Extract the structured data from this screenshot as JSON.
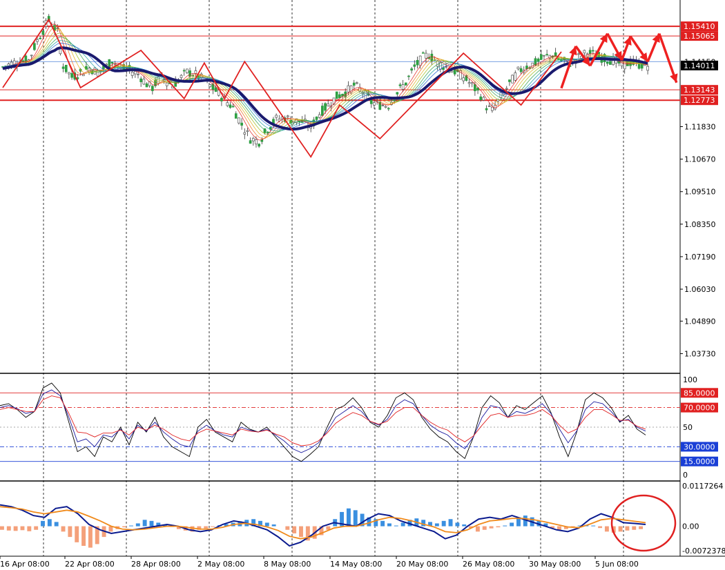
{
  "chart_data": [
    {
      "type": "line",
      "title": "",
      "price_axis": {
        "ylim": [
          1.0315,
          1.1625
        ],
        "tick_labels": [
          "1.11830",
          "1.10670",
          "1.09510",
          "1.08350",
          "1.07190",
          "1.06030",
          "1.04890",
          "1.03730"
        ],
        "tick_values": [
          1.1183,
          1.1067,
          1.0951,
          1.0835,
          1.0719,
          1.0603,
          1.0489,
          1.0373
        ]
      },
      "x_axis": {
        "date_labels": [
          "16 Apr 08:00",
          "22 Apr 08:00",
          "28 Apr 08:00",
          "2 May 08:00",
          "8 May 08:00",
          "14 May 08:00",
          "20 May 08:00",
          "26 May 08:00",
          "30 May 08:00",
          "5 Jun 08:00"
        ],
        "bar_count": 118
      },
      "price_path": [
        [
          0,
          1.1395
        ],
        [
          4,
          1.1412
        ],
        [
          9,
          1.142
        ],
        [
          12,
          1.149
        ],
        [
          16,
          1.1565
        ],
        [
          19,
          1.152
        ],
        [
          21,
          1.14
        ],
        [
          24,
          1.136
        ],
        [
          27,
          1.1375
        ],
        [
          30,
          1.1392
        ],
        [
          33,
          1.1378
        ],
        [
          36,
          1.1398
        ],
        [
          38,
          1.142
        ],
        [
          41,
          1.139
        ],
        [
          44,
          1.1385
        ],
        [
          47,
          1.137
        ],
        [
          50,
          1.1335
        ],
        [
          52,
          1.1322
        ],
        [
          55,
          1.1362
        ],
        [
          57,
          1.1345
        ],
        [
          59,
          1.133
        ],
        [
          62,
          1.1358
        ],
        [
          64,
          1.1378
        ],
        [
          67,
          1.1368
        ],
        [
          70,
          1.1348
        ],
        [
          73,
          1.132
        ],
        [
          76,
          1.129
        ],
        [
          80,
          1.125
        ],
        [
          83,
          1.119
        ],
        [
          86,
          1.114
        ],
        [
          89,
          1.113
        ],
        [
          92,
          1.1175
        ],
        [
          95,
          1.121
        ],
        [
          98,
          1.1215
        ],
        [
          101,
          1.1205
        ],
        [
          104,
          1.12
        ],
        [
          107,
          1.118
        ],
        [
          110,
          1.123
        ],
        [
          113,
          1.126
        ],
        [
          116,
          1.129
        ],
        [
          119,
          1.1305
        ],
        [
          122,
          1.133
        ],
        [
          125,
          1.131
        ],
        [
          128,
          1.127
        ],
        [
          131,
          1.126
        ],
        [
          134,
          1.126
        ],
        [
          137,
          1.1305
        ],
        [
          140,
          1.134
        ],
        [
          143,
          1.1395
        ],
        [
          146,
          1.143
        ],
        [
          148,
          1.144
        ],
        [
          151,
          1.141
        ],
        [
          154,
          1.1395
        ],
        [
          157,
          1.138
        ],
        [
          160,
          1.136
        ],
        [
          163,
          1.133
        ],
        [
          166,
          1.1295
        ],
        [
          168,
          1.1255
        ],
        [
          170,
          1.124
        ],
        [
          173,
          1.129
        ],
        [
          176,
          1.1335
        ],
        [
          179,
          1.138
        ],
        [
          182,
          1.1398
        ],
        [
          185,
          1.141
        ],
        [
          188,
          1.143
        ],
        [
          191,
          1.144
        ],
        [
          194,
          1.1418
        ],
        [
          197,
          1.141
        ],
        [
          200,
          1.143
        ],
        [
          203,
          1.1448
        ],
        [
          206,
          1.1438
        ],
        [
          209,
          1.1425
        ],
        [
          212,
          1.142
        ],
        [
          215,
          1.1402
        ],
        [
          218,
          1.1412
        ],
        [
          221,
          1.1405
        ],
        [
          224,
          1.1401
        ]
      ],
      "horizontal_levels": [
        {
          "value": 1.1541,
          "label": "1.15410",
          "style": "red-thick"
        },
        {
          "value": 1.15065,
          "label": "1.15065",
          "style": "red-thin"
        },
        {
          "value": 1.1415,
          "label": "1.14150",
          "style": "blue-thin"
        },
        {
          "value": 1.13143,
          "label": "1.13143",
          "style": "red-thin"
        },
        {
          "value": 1.12773,
          "label": "1.12773",
          "style": "red-thick"
        }
      ],
      "current_price": {
        "value": 1.14011,
        "label": "1.14011"
      },
      "zigzag": [
        [
          0,
          1.1322
        ],
        [
          16,
          1.1565
        ],
        [
          27,
          1.1322
        ],
        [
          48,
          1.1455
        ],
        [
          63,
          1.1283
        ],
        [
          70,
          1.141
        ],
        [
          77,
          1.1283
        ],
        [
          84,
          1.1415
        ],
        [
          107,
          1.1075
        ],
        [
          117,
          1.126
        ],
        [
          131,
          1.114
        ],
        [
          160,
          1.1445
        ],
        [
          180,
          1.126
        ],
        [
          194,
          1.145
        ]
      ],
      "forecast_arrows": [
        [
          194,
          1.132
        ],
        [
          199,
          1.147
        ],
        [
          204,
          1.14
        ],
        [
          210,
          1.1515
        ],
        [
          215,
          1.142
        ],
        [
          218,
          1.1505
        ],
        [
          224,
          1.1415
        ],
        [
          228,
          1.1515
        ],
        [
          234,
          1.134
        ]
      ],
      "colors": {
        "up": "#2ea043",
        "down": "#555555",
        "ma": "#1a1a6e",
        "zigzag": "#e02020",
        "level": "#e02020",
        "blue_level": "#4a7fd6"
      }
    },
    {
      "type": "line",
      "title": "",
      "y_axis": {
        "ylim": [
          0,
          100
        ],
        "tick_labels": [
          "100",
          "50",
          "0"
        ],
        "tick_values": [
          100,
          50,
          0
        ]
      },
      "levels": [
        {
          "value": 85,
          "label": "85.0000",
          "color": "#e02020"
        },
        {
          "value": 70,
          "label": "70.0000",
          "color": "#e02020"
        },
        {
          "value": 30,
          "label": "30.0000",
          "color": "#1a3fd6"
        },
        {
          "value": 15,
          "label": "15.0000",
          "color": "#1a3fd6"
        }
      ],
      "series": [
        {
          "values": [
            72,
            74,
            68,
            60,
            66,
            90,
            95,
            85,
            55,
            25,
            30,
            20,
            40,
            35,
            50,
            32,
            55,
            45,
            60,
            40,
            30,
            25,
            20,
            50,
            58,
            45,
            40,
            35,
            55,
            48,
            45,
            50,
            40,
            30,
            20,
            15,
            22,
            30,
            50,
            68,
            72,
            80,
            70,
            55,
            50,
            62,
            80,
            85,
            78,
            60,
            48,
            40,
            35,
            25,
            18,
            40,
            70,
            82,
            75,
            60,
            72,
            68,
            75,
            82,
            65,
            40,
            20,
            45,
            78,
            85,
            80,
            70,
            55,
            62,
            48,
            42
          ]
        },
        {
          "values": [
            70,
            72,
            69,
            64,
            66,
            84,
            88,
            82,
            60,
            35,
            38,
            30,
            42,
            40,
            48,
            38,
            52,
            46,
            55,
            45,
            38,
            32,
            30,
            46,
            52,
            46,
            42,
            40,
            50,
            47,
            45,
            48,
            42,
            36,
            28,
            24,
            28,
            34,
            46,
            60,
            66,
            72,
            66,
            56,
            52,
            58,
            72,
            78,
            74,
            62,
            52,
            46,
            42,
            34,
            28,
            40,
            60,
            72,
            70,
            60,
            66,
            64,
            68,
            74,
            64,
            48,
            34,
            46,
            68,
            76,
            74,
            66,
            56,
            58,
            50,
            46
          ]
        },
        {
          "values": [
            68,
            70,
            68,
            66,
            66,
            78,
            82,
            80,
            64,
            45,
            44,
            40,
            44,
            44,
            47,
            42,
            50,
            47,
            52,
            48,
            42,
            38,
            36,
            44,
            48,
            46,
            44,
            42,
            48,
            46,
            45,
            47,
            43,
            40,
            34,
            31,
            32,
            36,
            44,
            54,
            60,
            65,
            62,
            56,
            53,
            56,
            65,
            70,
            70,
            62,
            55,
            50,
            47,
            40,
            35,
            41,
            52,
            62,
            64,
            60,
            62,
            62,
            64,
            68,
            62,
            52,
            44,
            48,
            60,
            68,
            68,
            63,
            57,
            57,
            51,
            48
          ]
        }
      ],
      "colors": {
        "fast": "#000000",
        "mid": "#1a1a9e",
        "slow": "#e02020"
      }
    },
    {
      "type": "bar",
      "title": "",
      "y_axis": {
        "ylim": [
          -0.0072378,
          0.0117264
        ],
        "tick_labels": [
          "0.0117264",
          "0.00",
          "-0.0072378"
        ],
        "tick_values": [
          0.0117264,
          0.0,
          -0.0072378
        ]
      },
      "histogram": [
        -0.001,
        -0.0012,
        -0.0013,
        -0.0011,
        -0.0014,
        -0.001,
        0.0015,
        0.002,
        0.0012,
        -0.0015,
        -0.003,
        -0.0045,
        -0.0055,
        -0.006,
        -0.005,
        -0.003,
        -0.0015,
        -0.0008,
        -0.0003,
        0.0002,
        0.0008,
        0.0018,
        0.0015,
        0.001,
        0.0005,
        -0.0002,
        -0.0008,
        -0.0012,
        -0.0015,
        -0.001,
        -0.0006,
        -0.0002,
        0.0003,
        0.0006,
        0.001,
        0.0014,
        0.0018,
        0.002,
        0.0015,
        0.001,
        0.0005,
        0.0,
        -0.001,
        -0.002,
        -0.003,
        -0.004,
        -0.0035,
        -0.0025,
        -0.001,
        0.002,
        0.004,
        0.005,
        0.0045,
        0.0035,
        0.0025,
        0.002,
        0.0015,
        0.0008,
        0.0002,
        0.001,
        0.0018,
        0.0022,
        0.0018,
        0.0012,
        0.0008,
        0.0015,
        0.002,
        0.001,
        0.0005,
        -0.0005,
        -0.0015,
        -0.001,
        -0.0006,
        -0.0003,
        0.0002,
        0.001,
        0.0025,
        0.003,
        0.0025,
        0.0015,
        0.0008,
        -0.0005,
        -0.0012,
        -0.0008,
        -0.0003,
        0.0002,
        0.0004,
        0.0002,
        -0.0005,
        -0.0015,
        -0.0018,
        -0.0015,
        -0.0012,
        -0.001,
        -0.0008
      ],
      "macd_line": [
        0.006,
        0.0055,
        0.0045,
        0.003,
        0.0025,
        0.005,
        0.0055,
        0.0035,
        0.0005,
        -0.001,
        -0.002,
        -0.0015,
        -0.001,
        -0.0005,
        0.0,
        0.0005,
        0.0,
        -0.001,
        -0.0015,
        -0.001,
        0.0005,
        0.0015,
        0.001,
        0.0,
        -0.001,
        -0.003,
        -0.0055,
        -0.0045,
        -0.0025,
        0.0,
        0.001,
        0.0005,
        0.0,
        0.002,
        0.0035,
        0.003,
        0.0015,
        0.0005,
        -0.0005,
        -0.0015,
        -0.0035,
        -0.0025,
        0.0,
        0.002,
        0.0025,
        0.002,
        0.003,
        0.002,
        0.001,
        0.0,
        -0.001,
        -0.0015,
        -0.0005,
        0.002,
        0.0035,
        0.0025,
        0.001,
        0.0008,
        0.0005
      ],
      "signal_line": [
        0.0055,
        0.0052,
        0.0048,
        0.004,
        0.0035,
        0.004,
        0.0045,
        0.004,
        0.0028,
        0.0015,
        0.0,
        -0.0008,
        -0.001,
        -0.0008,
        -0.0004,
        0.0,
        0.0,
        -0.0004,
        -0.0008,
        -0.0008,
        -0.0003,
        0.0005,
        0.0008,
        0.0005,
        -0.0002,
        -0.0012,
        -0.0028,
        -0.0035,
        -0.003,
        -0.0018,
        -0.0005,
        0.0,
        0.0,
        0.0008,
        0.0018,
        0.0025,
        0.0022,
        0.0015,
        0.0006,
        -0.0002,
        -0.0015,
        -0.0018,
        -0.001,
        0.0005,
        0.0015,
        0.0018,
        0.0022,
        0.0022,
        0.0018,
        0.0012,
        0.0005,
        -0.0002,
        -0.0004,
        0.0006,
        0.0018,
        0.0022,
        0.0018,
        0.0014,
        0.001
      ],
      "colors": {
        "pos": "#3a8fe0",
        "neg": "#f4a07a",
        "macd": "#0a1a8e",
        "signal": "#f08a1a",
        "circle": "#e02020"
      }
    }
  ]
}
